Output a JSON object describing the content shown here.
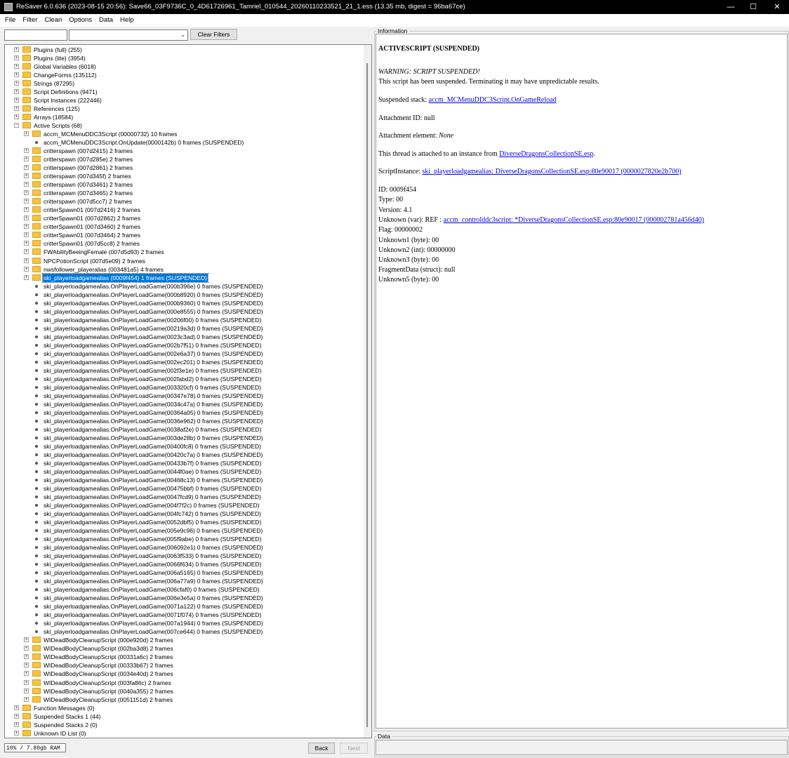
{
  "window": {
    "title": "ReSaver 6.0.636 (2023-08-15 20:56): Save66_03F9736C_0_4D61726961_Tamriel_010544_20260110233521_21_1.ess (13.35 mb, digest = 96ba67ce)",
    "minimize_glyph": "—",
    "maximize_glyph": "☐",
    "close_glyph": "✕"
  },
  "menu": [
    "File",
    "Filter",
    "Clean",
    "Options",
    "Data",
    "Help"
  ],
  "filter": {
    "text_value": "",
    "combo_value": "",
    "clear_label": "Clear Filters"
  },
  "tree": {
    "expand_glyph": "+",
    "collapse_glyph": "−",
    "top": [
      {
        "label": "Plugins (full) (255)"
      },
      {
        "label": "Plugins (lite) (3954)"
      },
      {
        "label": "Global Variables (6018)"
      },
      {
        "label": "ChangeForms (135112)"
      },
      {
        "label": "Strings (87295)"
      },
      {
        "label": "Script Definitions (9471)"
      },
      {
        "label": "Script Instances (222446)"
      },
      {
        "label": "References (125)"
      },
      {
        "label": "Arrays (18584)"
      }
    ],
    "active": {
      "label": "Active Scripts (68)"
    },
    "active_children": [
      {
        "label": "accm_MCMenuDDC3Script (00000732) 10 frames",
        "kind": "folder"
      },
      {
        "label": "accm_MCMenuDDC3Script.OnUpdate(0000142b) 0 frames (SUSPENDED)",
        "kind": "leaf"
      },
      {
        "label": "critterspawn (007d2415) 2 frames",
        "kind": "folder"
      },
      {
        "label": "critterspawn (007d285e) 2 frames",
        "kind": "folder"
      },
      {
        "label": "critterspawn (007d2861) 2 frames",
        "kind": "folder"
      },
      {
        "label": "critterspawn (007d345f) 2 frames",
        "kind": "folder"
      },
      {
        "label": "critterspawn (007d3461) 2 frames",
        "kind": "folder"
      },
      {
        "label": "critterspawn (007d3465) 2 frames",
        "kind": "folder"
      },
      {
        "label": "critterspawn (007d5cc7) 2 frames",
        "kind": "folder"
      },
      {
        "label": "critterSpawn01 (007d2416) 2 frames",
        "kind": "folder"
      },
      {
        "label": "critterSpawn01 (007d2862) 2 frames",
        "kind": "folder"
      },
      {
        "label": "critterSpawn01 (007d3460) 2 frames",
        "kind": "folder"
      },
      {
        "label": "critterSpawn01 (007d3464) 2 frames",
        "kind": "folder"
      },
      {
        "label": "critterSpawn01 (007d5cc8) 2 frames",
        "kind": "folder"
      },
      {
        "label": "FWAbilityBeeingFemale (007d5d93) 2 frames",
        "kind": "folder"
      },
      {
        "label": "NPCPotionScript (007d5e09) 2 frames",
        "kind": "folder"
      },
      {
        "label": "nwsfollower_playeralias (003481a5) 4 frames",
        "kind": "folder"
      },
      {
        "label": "ski_playerloadgamealias (0009f454) 1 frames (SUSPENDED)",
        "kind": "folder",
        "selected": true
      }
    ],
    "selected_children": [
      "ski_playerloadgamealias.OnPlayerLoadGame(000b396e) 0 frames (SUSPENDED)",
      "ski_playerloadgamealias.OnPlayerLoadGame(000b8920) 0 frames (SUSPENDED)",
      "ski_playerloadgamealias.OnPlayerLoadGame(000b9360) 0 frames (SUSPENDED)",
      "ski_playerloadgamealias.OnPlayerLoadGame(000e8555) 0 frames (SUSPENDED)",
      "ski_playerloadgamealias.OnPlayerLoadGame(00206f00) 0 frames (SUSPENDED)",
      "ski_playerloadgamealias.OnPlayerLoadGame(00219a3d) 0 frames (SUSPENDED)",
      "ski_playerloadgamealias.OnPlayerLoadGame(0023c3ad) 0 frames (SUSPENDED)",
      "ski_playerloadgamealias.OnPlayerLoadGame(002b7f51) 0 frames (SUSPENDED)",
      "ski_playerloadgamealias.OnPlayerLoadGame(002e6a37) 0 frames (SUSPENDED)",
      "ski_playerloadgamealias.OnPlayerLoadGame(002ec201) 0 frames (SUSPENDED)",
      "ski_playerloadgamealias.OnPlayerLoadGame(002f3e1e) 0 frames (SUSPENDED)",
      "ski_playerloadgamealias.OnPlayerLoadGame(002fabd2) 0 frames (SUSPENDED)",
      "ski_playerloadgamealias.OnPlayerLoadGame(003320cf) 0 frames (SUSPENDED)",
      "ski_playerloadgamealias.OnPlayerLoadGame(00347e78) 0 frames (SUSPENDED)",
      "ski_playerloadgamealias.OnPlayerLoadGame(0034c47a) 0 frames (SUSPENDED)",
      "ski_playerloadgamealias.OnPlayerLoadGame(00364a05) 0 frames (SUSPENDED)",
      "ski_playerloadgamealias.OnPlayerLoadGame(0036e962) 0 frames (SUSPENDED)",
      "ski_playerloadgamealias.OnPlayerLoadGame(0038af2e) 0 frames (SUSPENDED)",
      "ski_playerloadgamealias.OnPlayerLoadGame(003de28b) 0 frames (SUSPENDED)",
      "ski_playerloadgamealias.OnPlayerLoadGame(00400fc8) 0 frames (SUSPENDED)",
      "ski_playerloadgamealias.OnPlayerLoadGame(00420c7a) 0 frames (SUSPENDED)",
      "ski_playerloadgamealias.OnPlayerLoadGame(00433b7f) 0 frames (SUSPENDED)",
      "ski_playerloadgamealias.OnPlayerLoadGame(0044f0ae) 0 frames (SUSPENDED)",
      "ski_playerloadgamealias.OnPlayerLoadGame(00468c13) 0 frames (SUSPENDED)",
      "ski_playerloadgamealias.OnPlayerLoadGame(00475bbf) 0 frames (SUSPENDED)",
      "ski_playerloadgamealias.OnPlayerLoadGame(0047fcd9) 0 frames (SUSPENDED)",
      "ski_playerloadgamealias.OnPlayerLoadGame(004f7f2c) 0 frames (SUSPENDED)",
      "ski_playerloadgamealias.OnPlayerLoadGame(004fc742) 0 frames (SUSPENDED)",
      "ski_playerloadgamealias.OnPlayerLoadGame(0052dbf5) 0 frames (SUSPENDED)",
      "ski_playerloadgamealias.OnPlayerLoadGame(005e9c96) 0 frames (SUSPENDED)",
      "ski_playerloadgamealias.OnPlayerLoadGame(005f9abe) 0 frames (SUSPENDED)",
      "ski_playerloadgamealias.OnPlayerLoadGame(006092e1) 0 frames (SUSPENDED)",
      "ski_playerloadgamealias.OnPlayerLoadGame(0063f533) 0 frames (SUSPENDED)",
      "ski_playerloadgamealias.OnPlayerLoadGame(0066f634) 0 frames (SUSPENDED)",
      "ski_playerloadgamealias.OnPlayerLoadGame(006a5165) 0 frames (SUSPENDED)",
      "ski_playerloadgamealias.OnPlayerLoadGame(006a77a9) 0 frames (SUSPENDED)",
      "ski_playerloadgamealias.OnPlayerLoadGame(006cfaf0) 0 frames (SUSPENDED)",
      "ski_playerloadgamealias.OnPlayerLoadGame(006e3e5a) 0 frames (SUSPENDED)",
      "ski_playerloadgamealias.OnPlayerLoadGame(0071a122) 0 frames (SUSPENDED)",
      "ski_playerloadgamealias.OnPlayerLoadGame(0071f074) 0 frames (SUSPENDED)",
      "ski_playerloadgamealias.OnPlayerLoadGame(007a1944) 0 frames (SUSPENDED)",
      "ski_playerloadgamealias.OnPlayerLoadGame(007ce644) 0 frames (SUSPENDED)"
    ],
    "after_selected": [
      "WIDeadBodyCleanupScript (000e920d) 2 frames",
      "WIDeadBodyCleanupScript (002ba3d8) 2 frames",
      "WIDeadBodyCleanupScript (00331a6c) 2 frames",
      "WIDeadBodyCleanupScript (00333b67) 2 frames",
      "WIDeadBodyCleanupScript (0034e40d) 2 frames",
      "WIDeadBodyCleanupScript (003fa86c) 2 frames",
      "WIDeadBodyCleanupScript (0040a355) 2 frames",
      "WIDeadBodyCleanupScript (0051151d) 2 frames"
    ],
    "bottom": [
      {
        "label": "Function Messages (0)"
      },
      {
        "label": "Suspended Stacks 1 (44)"
      },
      {
        "label": "Suspended Stacks 2 (0)"
      },
      {
        "label": "Unknown ID List (0)"
      }
    ]
  },
  "status": {
    "memory": "10% / 7.80gb RAM",
    "back_label": "Back",
    "next_label": "Next"
  },
  "info": {
    "group_label": "Information",
    "heading": "ACTIVESCRIPT (SUSPENDED)",
    "warning": "WARNING: SCRIPT SUSPENDED!",
    "warning_body": "This script has been suspended. Terminating it may have unpredictable results.",
    "suspended_stack_prefix": "Suspended stack: ",
    "suspended_stack_link": "accm_MCMenuDDC3Script.OnGameReload",
    "attachment_id": "Attachment ID: null",
    "attachment_element_prefix": "Attachment element: ",
    "attachment_element_value": "None",
    "thread_prefix": "This thread is attached to an instance from ",
    "thread_link": "DiverseDragonsCollectionSE.esp",
    "thread_suffix": ".",
    "scriptinstance_prefix": "ScriptInstance: ",
    "scriptinstance_link": "ski_playerloadgamealias: DiverseDragonsCollectionSE.esp:80e90017 (0000027820e2b700)",
    "id": "ID: 0009f454",
    "type": "Type: 00",
    "version": "Version: 4.1",
    "unknown_var_prefix": "Unknown (var): REF : ",
    "unknown_var_link": "accm_controlddc3script: *DiverseDragonsCollectionSE.esp:80e90017 (000002781a456d40)",
    "flag": "Flag: 00000002",
    "unknown1": "Unknown1 (byte): 00",
    "unknown2": "Unknown2 (int): 00000000",
    "unknown3": "Unknown3 (byte): 00",
    "fragment": "FragmentData (struct): null",
    "unknown5": "Unknown5 (byte): 00"
  },
  "data_panel": {
    "group_label": "Data"
  }
}
